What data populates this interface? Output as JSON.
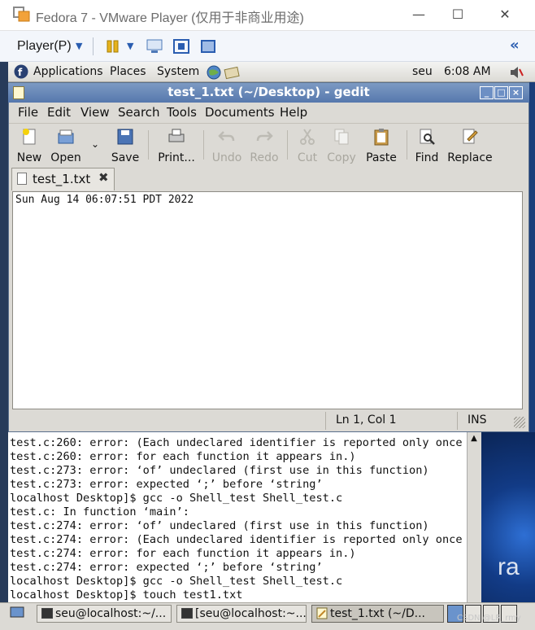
{
  "vm": {
    "title": "Fedora 7 - VMware Player (仅用于非商业用途)",
    "player_menu": "Player(P)",
    "controls": {
      "minimize": "—",
      "maximize": "☐",
      "close": "✕"
    },
    "forward_icon": "«"
  },
  "gnome_panel": {
    "applications": "Applications",
    "places": "Places",
    "system": "System",
    "user": "seu",
    "clock": "6:08 AM"
  },
  "gedit": {
    "title": "test_1.txt (~/Desktop) - gedit",
    "menu": [
      "File",
      "Edit",
      "View",
      "Search",
      "Tools",
      "Documents",
      "Help"
    ],
    "toolbar": {
      "new": "New",
      "open": "Open",
      "save": "Save",
      "print": "Print...",
      "undo": "Undo",
      "redo": "Redo",
      "cut": "Cut",
      "copy": "Copy",
      "paste": "Paste",
      "find": "Find",
      "replace": "Replace"
    },
    "tab_label": "test_1.txt",
    "tab_close": "✖",
    "content": "Sun Aug 14 06:07:51 PDT 2022",
    "status": {
      "position": "Ln 1, Col 1",
      "mode": "INS"
    }
  },
  "terminal": {
    "lines": [
      "test.c:260: error: (Each undeclared identifier is reported only once",
      "test.c:260: error: for each function it appears in.)",
      "test.c:273: error: ‘of’ undeclared (first use in this function)",
      "test.c:273: error: expected ‘;’ before ‘string’",
      "localhost Desktop]$ gcc -o Shell_test Shell_test.c",
      "test.c: In function ‘main’:",
      "test.c:274: error: ‘of’ undeclared (first use in this function)",
      "test.c:274: error: (Each undeclared identifier is reported only once",
      "test.c:274: error: for each function it appears in.)",
      "test.c:274: error: expected ‘;’ before ‘string’",
      "localhost Desktop]$ gcc -o Shell_test Shell_test.c",
      "localhost Desktop]$ touch test1.txt"
    ]
  },
  "desktop": {
    "brand_fragment": "ra"
  },
  "taskbar": {
    "items": [
      {
        "label": "seu@localhost:~/..."
      },
      {
        "label": "[seu@localhost:~..."
      },
      {
        "label": "test_1.txt (~/D..."
      }
    ],
    "watermark": "CSDN @LR_rmy"
  }
}
